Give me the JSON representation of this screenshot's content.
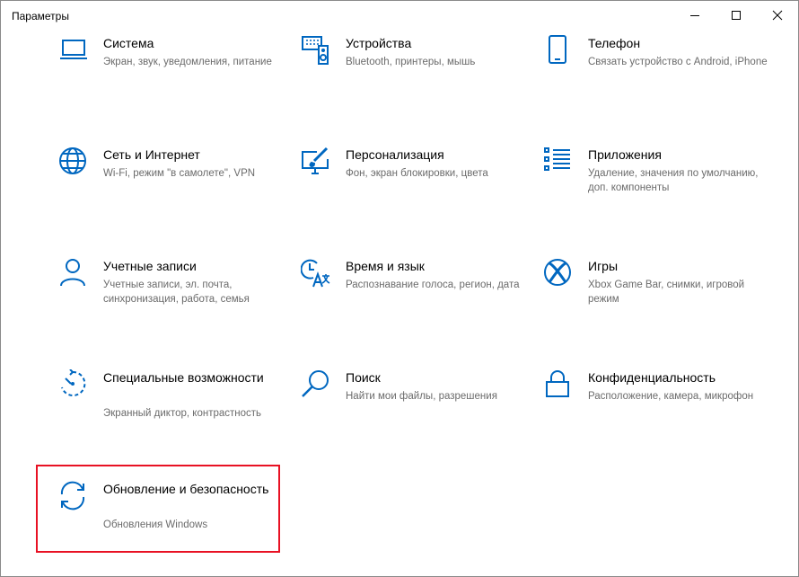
{
  "window": {
    "title": "Параметры"
  },
  "colors": {
    "accent": "#0067c0",
    "highlight": "#e81123"
  },
  "tiles": [
    {
      "icon": "laptop-icon",
      "title": "Система",
      "desc": "Экран, звук, уведомления, питание"
    },
    {
      "icon": "keyboard-speaker-icon",
      "title": "Устройства",
      "desc": "Bluetooth, принтеры, мышь"
    },
    {
      "icon": "phone-icon",
      "title": "Телефон",
      "desc": "Связать устройство с Android, iPhone"
    },
    {
      "icon": "globe-icon",
      "title": "Сеть и Интернет",
      "desc": "Wi-Fi, режим \"в самолете\", VPN"
    },
    {
      "icon": "paint-monitor-icon",
      "title": "Персонализация",
      "desc": "Фон, экран блокировки, цвета"
    },
    {
      "icon": "apps-list-icon",
      "title": "Приложения",
      "desc": "Удаление, значения по умолчанию, доп. компоненты"
    },
    {
      "icon": "person-icon",
      "title": "Учетные записи",
      "desc": "Учетные записи, эл. почта, синхронизация, работа, семья"
    },
    {
      "icon": "time-language-icon",
      "title": "Время и язык",
      "desc": "Распознавание голоса, регион, дата"
    },
    {
      "icon": "xbox-icon",
      "title": "Игры",
      "desc": "Xbox Game Bar, снимки, игровой режим"
    },
    {
      "icon": "accessibility-icon",
      "title": "Специальные возможности",
      "desc": "Экранный диктор, контрастность"
    },
    {
      "icon": "search-icon",
      "title": "Поиск",
      "desc": "Найти мои файлы, разрешения"
    },
    {
      "icon": "lock-icon",
      "title": "Конфиденциальность",
      "desc": "Расположение, камера, микрофон"
    },
    {
      "icon": "sync-icon",
      "title": "Обновление и безопасность",
      "desc": "Обновления Windows"
    }
  ]
}
